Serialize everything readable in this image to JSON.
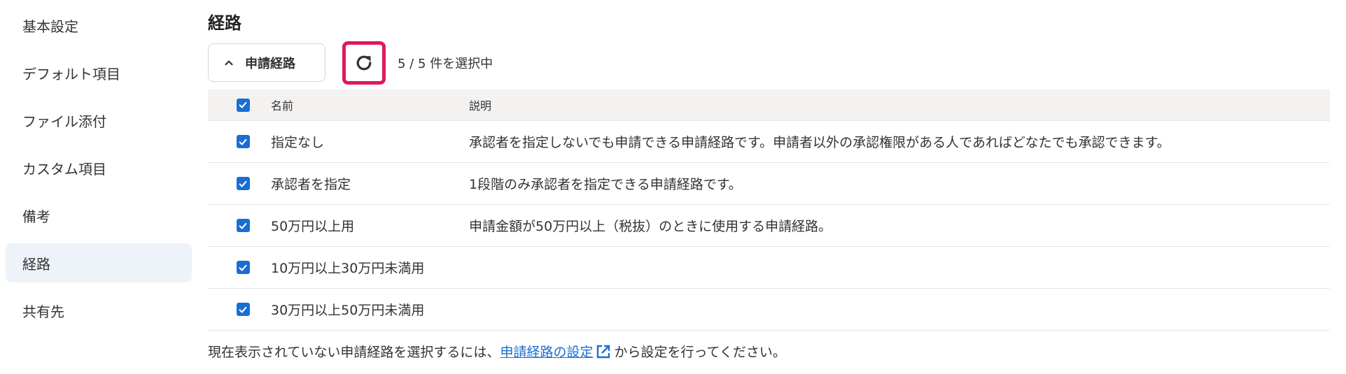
{
  "sidebar": {
    "items": [
      {
        "label": "基本設定"
      },
      {
        "label": "デフォルト項目"
      },
      {
        "label": "ファイル添付"
      },
      {
        "label": "カスタム項目"
      },
      {
        "label": "備考"
      },
      {
        "label": "経路"
      },
      {
        "label": "共有先"
      }
    ],
    "active": "経路"
  },
  "section": {
    "title": "経路"
  },
  "toolbar": {
    "toggle_label": "申請経路",
    "selected_count": "5 / 5 件を選択中"
  },
  "table": {
    "headers": {
      "name": "名前",
      "description": "説明"
    },
    "rows": [
      {
        "name": "指定なし",
        "description": "承認者を指定しないでも申請できる申請経路です。申請者以外の承認権限がある人であればどなたでも承認できます。"
      },
      {
        "name": "承認者を指定",
        "description": "1段階のみ承認者を指定できる申請経路です。"
      },
      {
        "name": "50万円以上用",
        "description": "申請金額が50万円以上（税抜）のときに使用する申請経路。"
      },
      {
        "name": "10万円以上30万円未満用",
        "description": ""
      },
      {
        "name": "30万円以上50万円未満用",
        "description": ""
      }
    ]
  },
  "footer": {
    "before": "現在表示されていない申請経路を選択するには、",
    "link": "申請経路の設定",
    "after": "から設定を行ってください。"
  },
  "colors": {
    "accent": "#1a6dd5",
    "highlight": "#e0185f",
    "active_bg": "#eef3fa"
  }
}
